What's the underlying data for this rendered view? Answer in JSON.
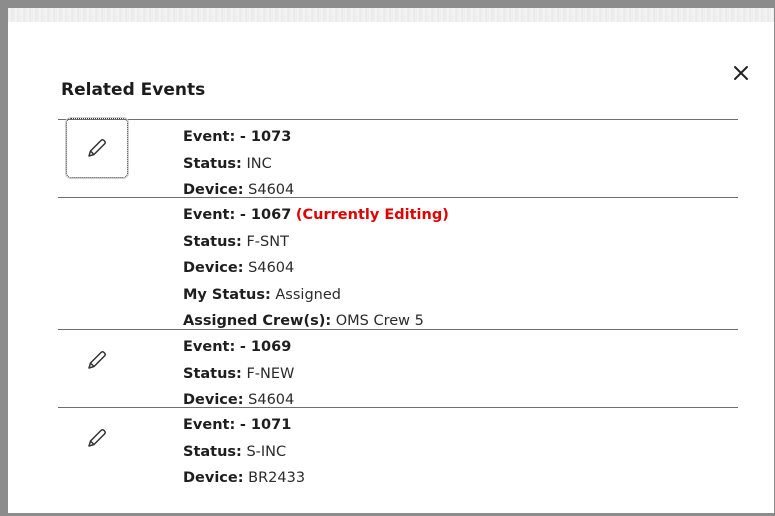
{
  "dialog": {
    "title": "Related Events",
    "close_icon": "close-icon"
  },
  "labels": {
    "event": "Event:",
    "status": "Status:",
    "device": "Device:",
    "my_status": "My Status:",
    "assigned_crews": "Assigned Crew(s):"
  },
  "events": [
    {
      "event": "- 1073",
      "status": "INC",
      "device": "S4604",
      "edit_icon": "pencil-icon"
    },
    {
      "event": "- 1067",
      "editing_note": "(Currently Editing)",
      "status": "F-SNT",
      "device": "S4604",
      "my_status": "Assigned",
      "assigned_crews": "OMS Crew 5"
    },
    {
      "event": "- 1069",
      "status": "F-NEW",
      "device": "S4604",
      "edit_icon": "pencil-icon"
    },
    {
      "event": "- 1071",
      "status": "S-INC",
      "device": "BR2433",
      "edit_icon": "pencil-icon"
    }
  ],
  "colors": {
    "editing_note": "#e00000",
    "divider": "#6e6e6e",
    "backdrop": "#8c8c8c"
  }
}
